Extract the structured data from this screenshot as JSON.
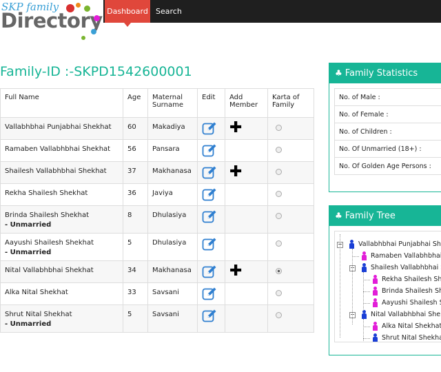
{
  "nav": {
    "dashboard": "Dashboard",
    "search": "Search"
  },
  "logo": {
    "top": "SKP family",
    "main": "Directory"
  },
  "page_title": "Family-ID :-SKPD1542600001",
  "table": {
    "headers": [
      "Full Name",
      "Age",
      "Maternal Surname",
      "Edit",
      "Add Member",
      "Karta of Family"
    ],
    "rows": [
      {
        "name": "Vallabhbhai Punjabhai Shekhat",
        "note": "",
        "age": "60",
        "surname": "Makadiya",
        "add": true,
        "karta": false
      },
      {
        "name": "Ramaben Vallabhbhai Shekhat",
        "note": "",
        "age": "56",
        "surname": "Pansara",
        "add": false,
        "karta": false
      },
      {
        "name": "Shailesh Vallabhbhai Shekhat",
        "note": "",
        "age": "37",
        "surname": "Makhanasa",
        "add": true,
        "karta": false
      },
      {
        "name": "Rekha Shailesh Shekhat",
        "note": "",
        "age": "36",
        "surname": "Javiya",
        "add": false,
        "karta": false
      },
      {
        "name": "Brinda Shailesh Shekhat",
        "note": "- Unmarried",
        "age": "8",
        "surname": "Dhulasiya",
        "add": false,
        "karta": false
      },
      {
        "name": "Aayushi Shailesh Shekhat",
        "note": "- Unmarried",
        "age": "5",
        "surname": "Dhulasiya",
        "add": false,
        "karta": false
      },
      {
        "name": "Nital Vallabhbhai Shekhat",
        "note": "",
        "age": "34",
        "surname": "Makhanasa",
        "add": true,
        "karta": true
      },
      {
        "name": "Alka Nital Shekhat",
        "note": "",
        "age": "33",
        "surname": "Savsani",
        "add": false,
        "karta": false
      },
      {
        "name": "Shrut Nital Shekhat",
        "note": "- Unmarried",
        "age": "5",
        "surname": "Savsani",
        "add": false,
        "karta": false
      }
    ]
  },
  "stats_panel": {
    "title": "Family Statistics",
    "rows": [
      "No. of Male :",
      "No. of Female :",
      "No. of Children :",
      "No. Of Unmarried (18+) :",
      "No. Of Golden Age Persons :"
    ]
  },
  "tree_panel": {
    "title": "Family Tree",
    "nodes": [
      {
        "label": "Vallabhbhai Punjabhai Shekhat",
        "gender": "male",
        "level": 0,
        "toggle": true
      },
      {
        "label": "Ramaben Vallabhbhai Shekhat",
        "gender": "female",
        "level": 1,
        "toggle": false
      },
      {
        "label": "Shailesh Vallabhbhai Shekhat",
        "gender": "male",
        "level": 1,
        "toggle": true
      },
      {
        "label": "Rekha Shailesh Shekhat",
        "gender": "female",
        "level": 2,
        "toggle": false
      },
      {
        "label": "Brinda Shailesh Shekhat",
        "gender": "female",
        "level": 2,
        "toggle": false
      },
      {
        "label": "Aayushi Shailesh Shekhat",
        "gender": "female",
        "level": 2,
        "toggle": false
      },
      {
        "label": "Nital Vallabhbhai Shekhat",
        "gender": "male",
        "level": 1,
        "toggle": true
      },
      {
        "label": "Alka Nital Shekhat (",
        "gender": "female",
        "level": 2,
        "toggle": false
      },
      {
        "label": "Shrut Nital Shekhat",
        "gender": "male",
        "level": 2,
        "toggle": false
      }
    ]
  },
  "colors": {
    "accent": "#17b596",
    "nav_active": "#e0473b",
    "navbar": "#1f1f1f",
    "male": "#1a3fd6",
    "female": "#e21ed8"
  }
}
